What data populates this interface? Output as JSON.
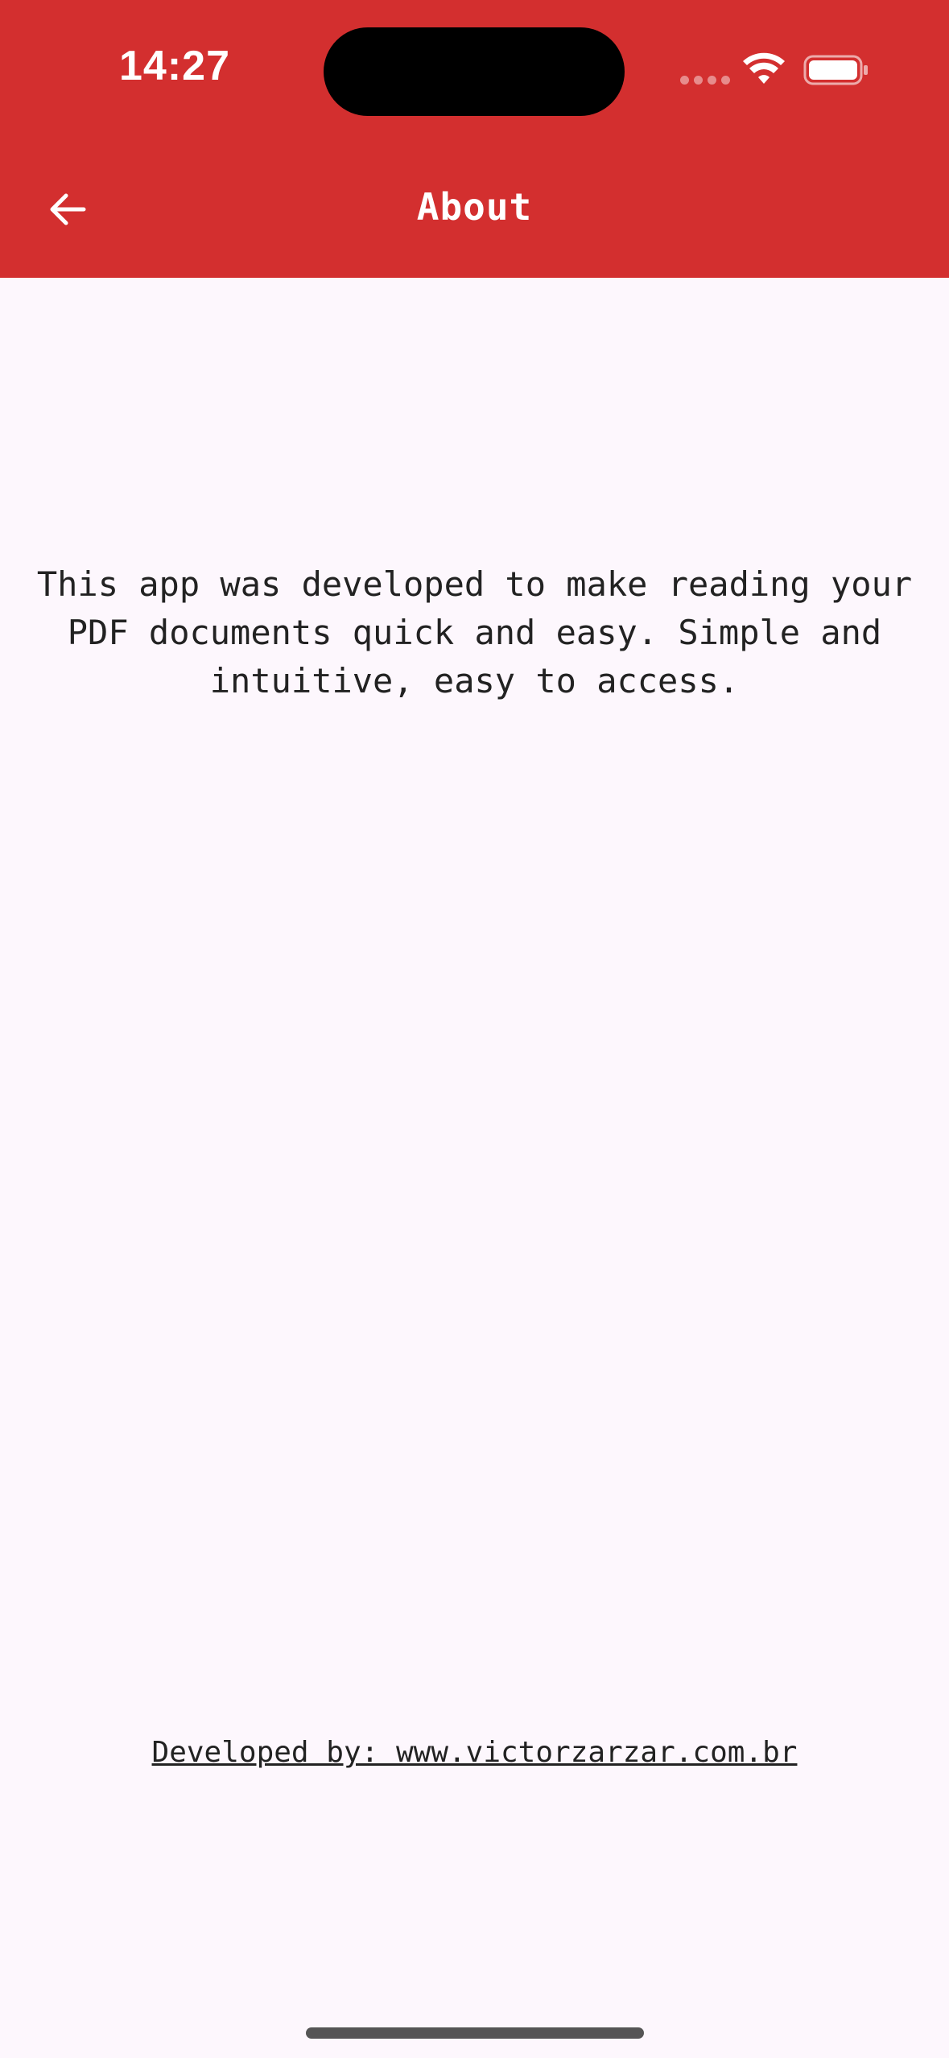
{
  "status_bar": {
    "time": "14:27"
  },
  "app_bar": {
    "title": "About",
    "back_icon": "arrow-left-icon",
    "color": "#d32f2f"
  },
  "content": {
    "description": "This app was developed to make reading your PDF documents quick and easy. Simple and intuitive, easy to access.",
    "developer_credit": "Developed by: www.victorzarzar.com.br"
  }
}
